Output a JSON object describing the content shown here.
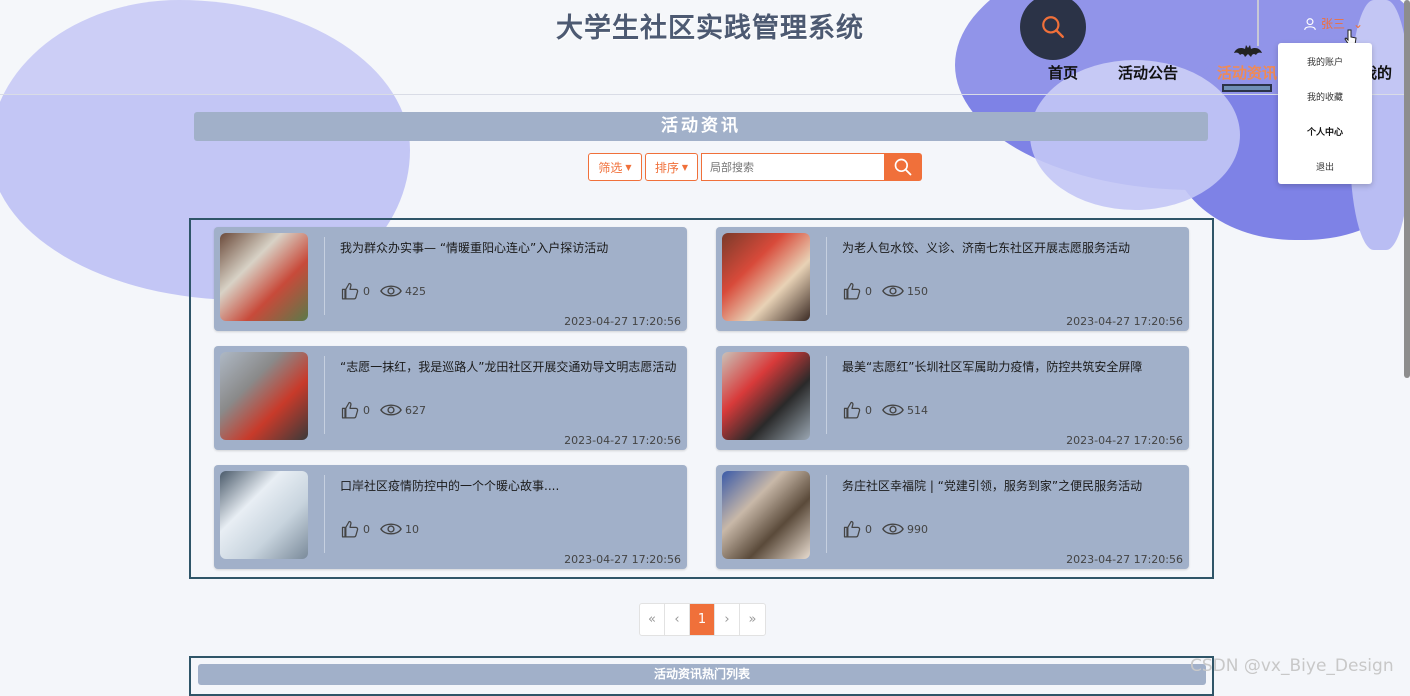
{
  "header": {
    "site_title": "大学生社区实践管理系统",
    "nav": [
      "首页",
      "活动公告",
      "活动资讯",
      "我的"
    ],
    "nav_active_index": 2,
    "user_name": "张三",
    "user_icon": "user-icon",
    "search_icon": "search-icon"
  },
  "user_menu": [
    "我的账户",
    "我的收藏",
    "个人中心",
    "退出"
  ],
  "section": {
    "title": "活动资讯",
    "filter_label": "筛选",
    "sort_label": "排序",
    "search_placeholder": "局部搜索",
    "search_value": ""
  },
  "news": [
    {
      "title": "我为群众办实事— “情暖重阳心连心”入户探访活动",
      "likes": "0",
      "views": "425",
      "date": "2023-04-27 17:20:56",
      "thumb_colors": [
        "#6b4a3a",
        "#d8d2c6",
        "#c84a3a",
        "#5a7a4a"
      ]
    },
    {
      "title": "为老人包水饺、义诊、济南七东社区开展志愿服务活动",
      "likes": "0",
      "views": "150",
      "date": "2023-04-27 17:20:56",
      "thumb_colors": [
        "#7a3a2a",
        "#d84a3a",
        "#e8d2b6",
        "#3a2a24"
      ]
    },
    {
      "title": "“志愿一抹红，我是巡路人”龙田社区开展交通劝导文明志愿活动",
      "likes": "0",
      "views": "627",
      "date": "2023-04-27 17:20:56",
      "thumb_colors": [
        "#aeb8c4",
        "#8a8a8a",
        "#c83a2a",
        "#3a3a3a"
      ]
    },
    {
      "title": "最美“志愿红”长圳社区军属助力疫情，防控共筑安全屏障",
      "likes": "0",
      "views": "514",
      "date": "2023-04-27 17:20:56",
      "thumb_colors": [
        "#c9c2b8",
        "#d83a3a",
        "#2a2a2a",
        "#9aa6b2"
      ]
    },
    {
      "title": "口岸社区疫情防控中的一个个暖心故事....",
      "likes": "0",
      "views": "10",
      "date": "2023-04-27 17:20:56",
      "thumb_colors": [
        "#4a5a6a",
        "#e8eef4",
        "#c8d4de",
        "#7a8a9a"
      ]
    },
    {
      "title": "务庄社区幸福院 | “党建引领，服务到家”之便民服务活动",
      "likes": "0",
      "views": "990",
      "date": "2023-04-27 17:20:56",
      "thumb_colors": [
        "#3a5aa8",
        "#c8b8a8",
        "#5a4a3a",
        "#e8dcd0"
      ]
    }
  ],
  "pagination": [
    "«",
    "‹",
    "1",
    "›",
    "»"
  ],
  "pagination_active_index": 2,
  "hot_section": {
    "title": "活动资讯热门列表"
  },
  "watermark": "CSDN @vx_Biye_Design",
  "colors": {
    "accent": "#f0703a",
    "card": "#a1b0c9",
    "frame": "#2f5568",
    "blob": "#7e82e6"
  }
}
